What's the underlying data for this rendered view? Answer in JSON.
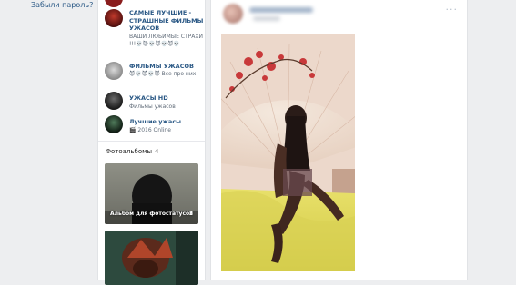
{
  "login": {
    "forgot_password": "Забыли пароль?"
  },
  "groups": [
    {
      "title": "САМЫЕ ЛУЧШИЕ - СТРАШНЫЕ ФИЛЬМЫ УЖАСОВ",
      "subtitle": "ВАШИ ЛЮБИМЫЕ СТРАХИ !!!💀😈💀😈💀😈💀"
    },
    {
      "title": "ФИЛЬМЫ УЖАСОВ",
      "subtitle": "😈💀😈💀😈 Все про них!"
    },
    {
      "title": "УЖАСЫ HD",
      "subtitle": "Фильмы ужасов"
    },
    {
      "title": "Лучшие ужасы",
      "subtitle": "🎬 2016 Online"
    }
  ],
  "albums": {
    "title": "Фотоальбомы",
    "count": "4",
    "items": [
      {
        "caption": "Альбом для фотостатусов",
        "count": "3"
      },
      {
        "caption": "",
        "count": ""
      }
    ]
  },
  "post": {
    "more_label": "···"
  },
  "colors": {
    "link": "#2a5885",
    "background": "#edeef0",
    "card": "#ffffff"
  }
}
